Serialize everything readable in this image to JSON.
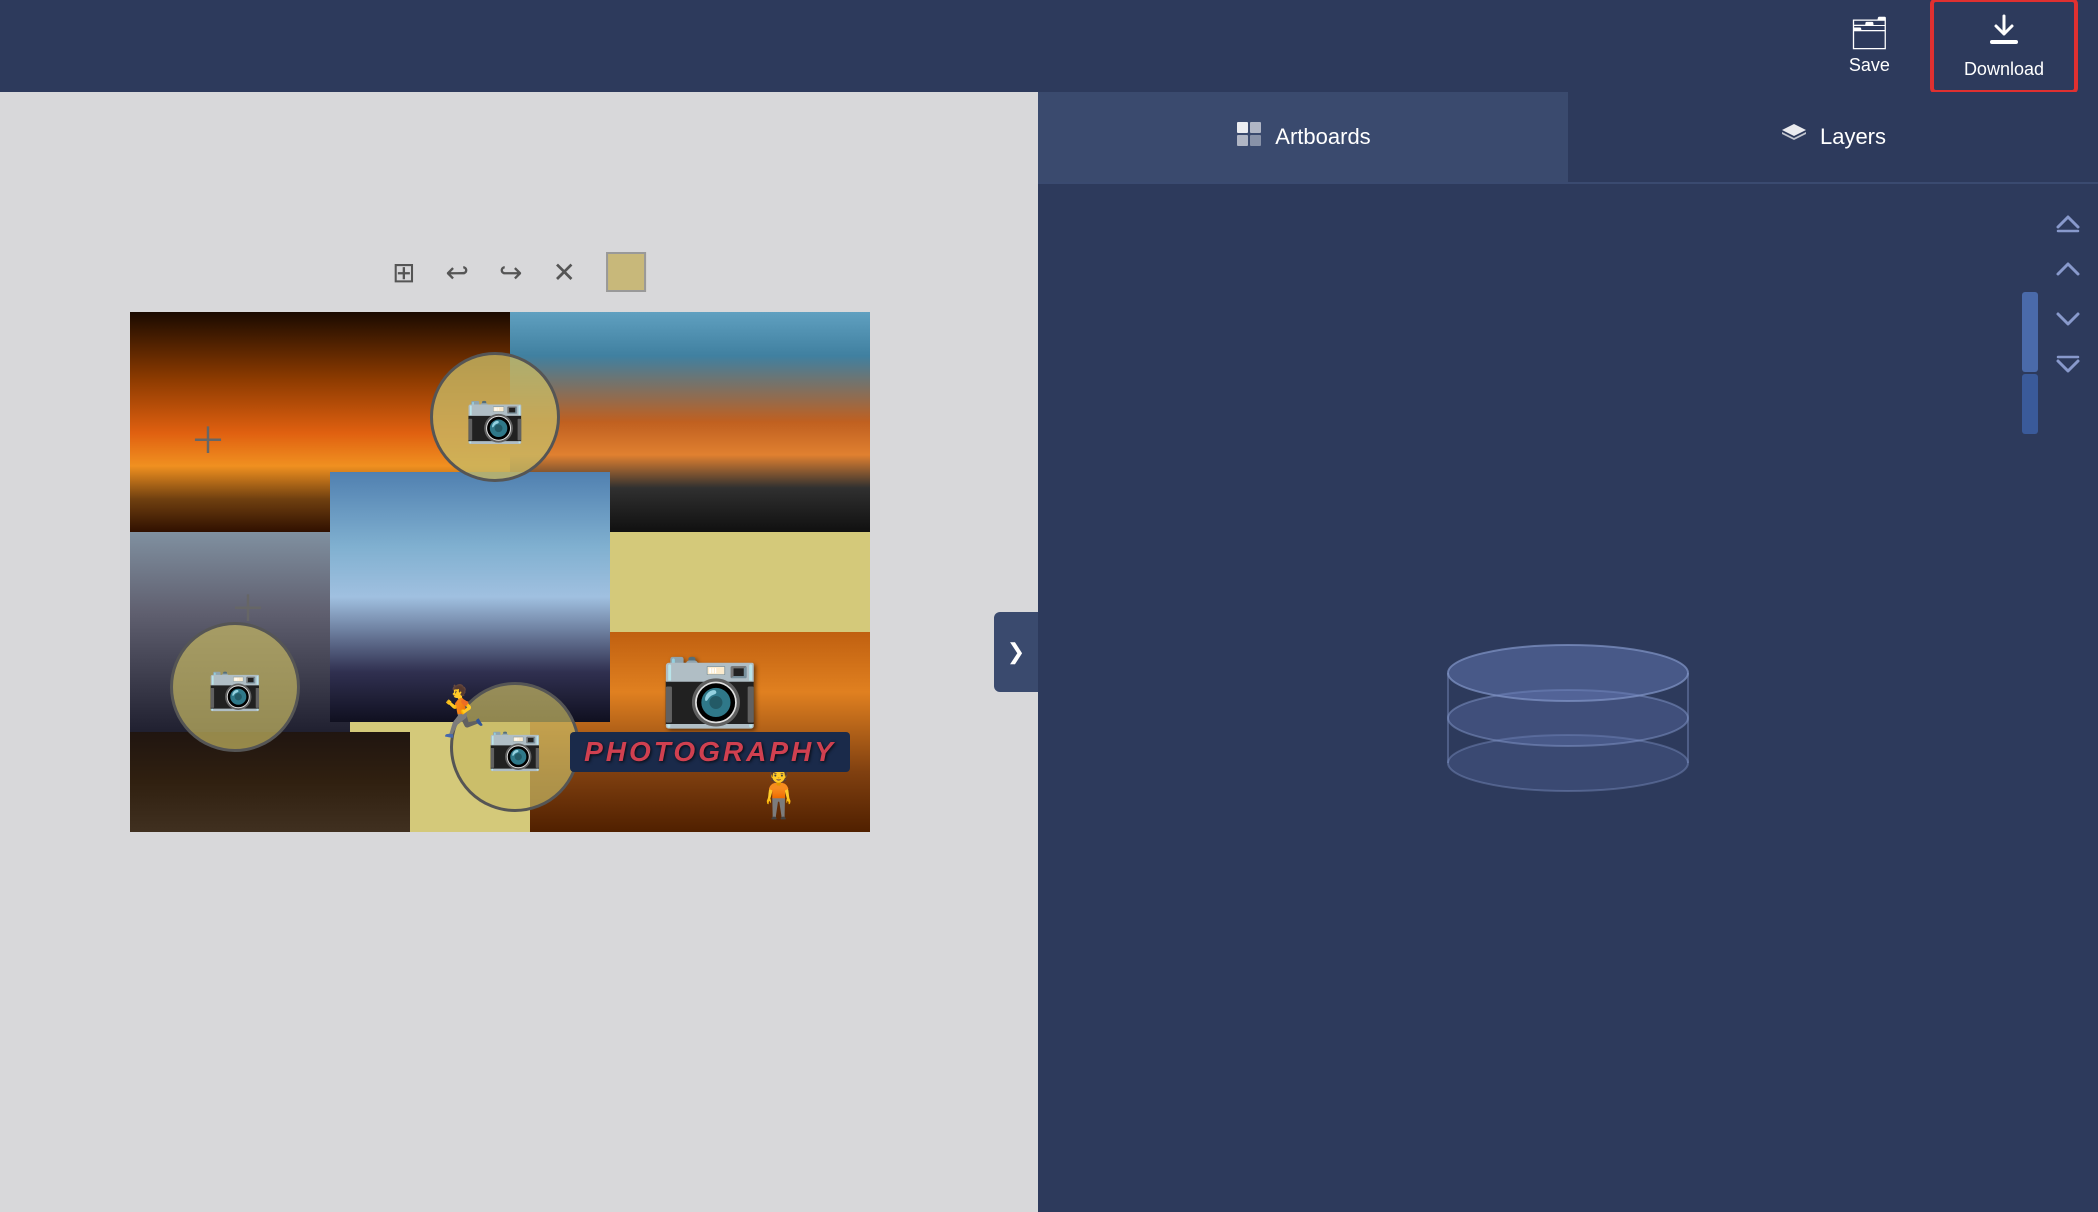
{
  "header": {
    "save_label": "Save",
    "download_label": "Download",
    "save_icon": "🗂",
    "download_icon": "⬇"
  },
  "sidebar": {
    "tab_artboards_label": "Artboards",
    "tab_layers_label": "Layers",
    "tab_artboards_icon": "⬜",
    "tab_layers_icon": "◈",
    "collapse_icon": "❯",
    "arrow_up_top": "⏫",
    "arrow_up": "⬆",
    "arrow_down": "⬇",
    "arrow_down_bottom": "⏬"
  },
  "canvas": {
    "toolbar": {
      "grid_icon": "⊞",
      "undo_icon": "↩",
      "redo_icon": "↪",
      "close_icon": "✕",
      "color_swatch": "#c8b87a"
    }
  }
}
